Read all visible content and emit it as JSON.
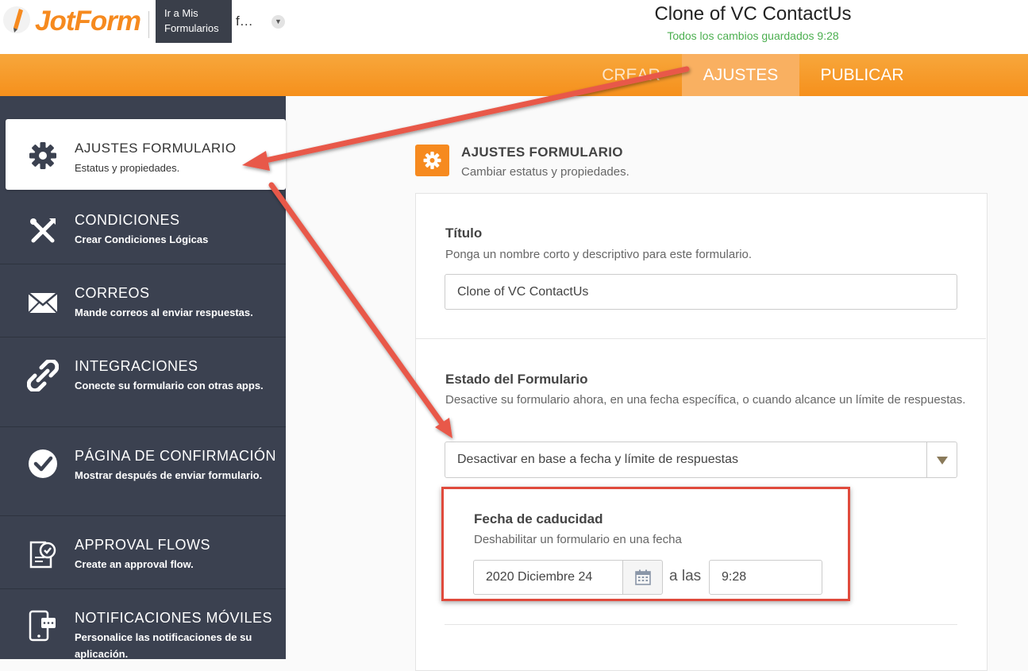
{
  "header": {
    "logo_text": "JotForm",
    "tooltip": "Ir a Mis Formularios",
    "form_short": "f…",
    "title": "Clone of VC ContactUs",
    "saved_status": "Todos los cambios guardados 9:28"
  },
  "tabs": [
    {
      "label": "CREAR"
    },
    {
      "label": "AJUSTES"
    },
    {
      "label": "PUBLICAR"
    }
  ],
  "sidebar": {
    "items": [
      {
        "title": "AJUSTES FORMULARIO",
        "subtitle": "Estatus y propiedades.",
        "icon": "gear-icon"
      },
      {
        "title": "CONDICIONES",
        "subtitle": "Crear Condiciones Lógicas",
        "icon": "conditions-icon"
      },
      {
        "title": "CORREOS",
        "subtitle": "Mande correos al enviar respuestas.",
        "icon": "envelope-icon"
      },
      {
        "title": "INTEGRACIONES",
        "subtitle": "Conecte su formulario con otras apps.",
        "icon": "link-icon"
      },
      {
        "title": "PÁGINA DE CONFIRMACIÓN",
        "subtitle": "Mostrar después de enviar formulario.",
        "icon": "check-circle-icon"
      },
      {
        "title": "APPROVAL FLOWS",
        "subtitle": "Create an approval flow.",
        "icon": "approval-icon"
      },
      {
        "title": "NOTIFICACIONES MÓVILES",
        "subtitle": "Personalice las notificaciones de su aplicación.",
        "icon": "mobile-icon"
      }
    ]
  },
  "main": {
    "section_title": "AJUSTES FORMULARIO",
    "section_subtitle": "Cambiar estatus y propiedades.",
    "title_label": "Título",
    "title_desc": "Ponga un nombre corto y descriptivo para este formulario.",
    "title_value": "Clone of VC ContactUs",
    "status_label": "Estado del Formulario",
    "status_desc": "Desactive su formulario ahora, en una fecha específica, o cuando alcance un límite de respuestas.",
    "status_value": "Desactivar en base a fecha y límite de respuestas",
    "expiry_label": "Fecha de caducidad",
    "expiry_desc": "Deshabilitar un formulario en una fecha",
    "date_value": "2020 Diciembre 24",
    "at_label": "a las",
    "time_value": "9:28"
  },
  "colors": {
    "accent": "#f68a1f",
    "sidebar_bg": "#3b4150",
    "saved_green": "#4caf50",
    "annotation_red": "#e04a3c"
  }
}
